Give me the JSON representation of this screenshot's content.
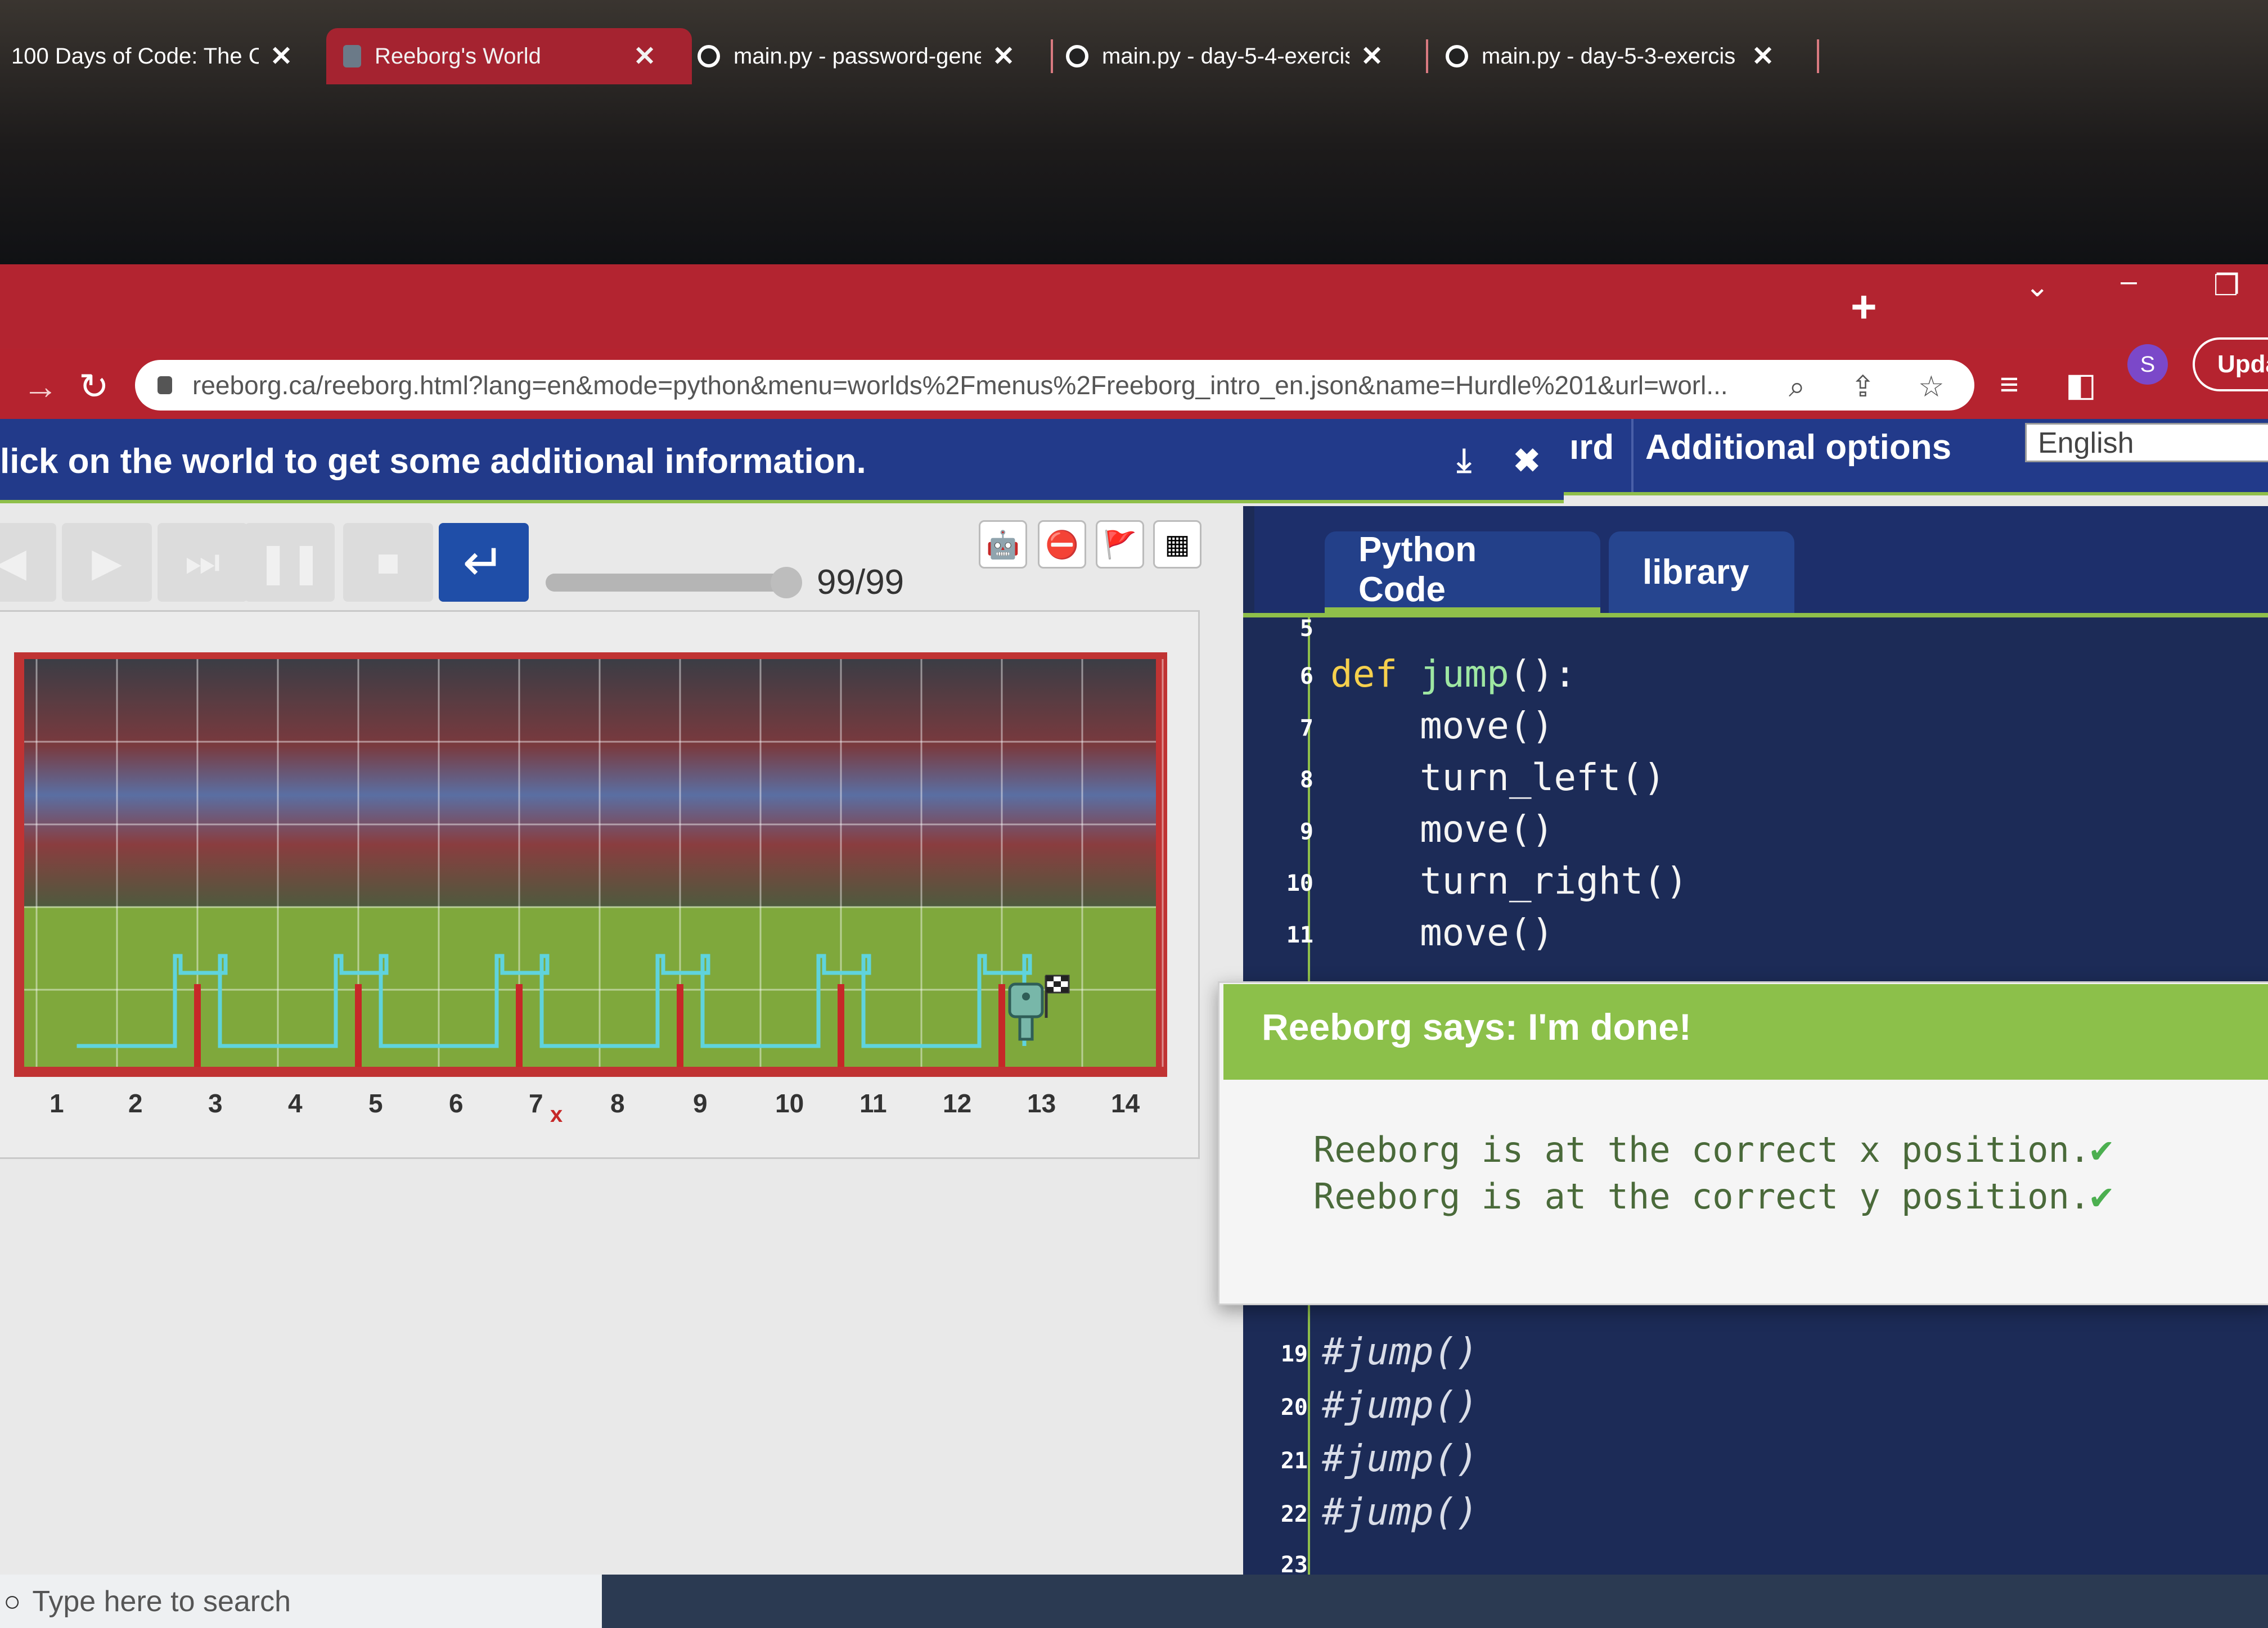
{
  "browser": {
    "tabs": [
      {
        "title": "100 Days of Code: The C",
        "active": false
      },
      {
        "title": "Reeborg's World",
        "active": true
      },
      {
        "title": "main.py - password-gene",
        "active": false
      },
      {
        "title": "main.py - day-5-4-exercis",
        "active": false
      },
      {
        "title": "main.py - day-5-3-exercis",
        "active": false
      }
    ],
    "new_tab": "+",
    "url": "reeborg.ca/reeborg.html?lang=en&mode=python&menu=worlds%2Fmenus%2Freeborg_intro_en.json&name=Hurdle%201&url=worl...",
    "profile_initial": "S",
    "update_label": "Upda"
  },
  "infobar": {
    "message": "lick on the world to get some additional information.",
    "pin_icon": "⤓",
    "close_icon": "✖"
  },
  "menu": {
    "partial_item": "ırd",
    "additional_options": "Additional options",
    "language": "English"
  },
  "controls": {
    "step_counter": "99/99",
    "progress_fraction": 1.0
  },
  "world": {
    "x_labels": [
      "1",
      "2",
      "3",
      "4",
      "5",
      "6",
      "7",
      "8",
      "9",
      "10",
      "11",
      "12",
      "13",
      "14"
    ],
    "x_marker": "x",
    "colors": {
      "wall": "#c62828",
      "trace": "#5fd3dd",
      "grass": "#7fa83c",
      "border": "#d23a3a"
    }
  },
  "editor": {
    "tabs": [
      {
        "label": "Python Code",
        "active": true
      },
      {
        "label": "library",
        "active": false
      }
    ],
    "lines_top": [
      {
        "n": "5",
        "text": ""
      },
      {
        "n": "6",
        "kw": "def ",
        "fn": "jump",
        "rest": "():"
      },
      {
        "n": "7",
        "text": "    move()"
      },
      {
        "n": "8",
        "text": "    turn_left()"
      },
      {
        "n": "9",
        "text": "    move()"
      },
      {
        "n": "10",
        "text": "    turn_right()"
      },
      {
        "n": "11",
        "text": "    move()"
      }
    ],
    "lines_bottom": [
      {
        "n": "19",
        "text": "#jump()"
      },
      {
        "n": "20",
        "text": "#jump()"
      },
      {
        "n": "21",
        "text": "#jump()"
      },
      {
        "n": "22",
        "text": "#jump()"
      },
      {
        "n": "23",
        "text": ""
      }
    ]
  },
  "dialog": {
    "title": "Reeborg says: I'm done!",
    "lines": [
      "Reeborg is at the correct x position.",
      "Reeborg is at the correct y position."
    ],
    "check": "✔"
  },
  "taskbar": {
    "search_placeholder": "Type here to search"
  }
}
